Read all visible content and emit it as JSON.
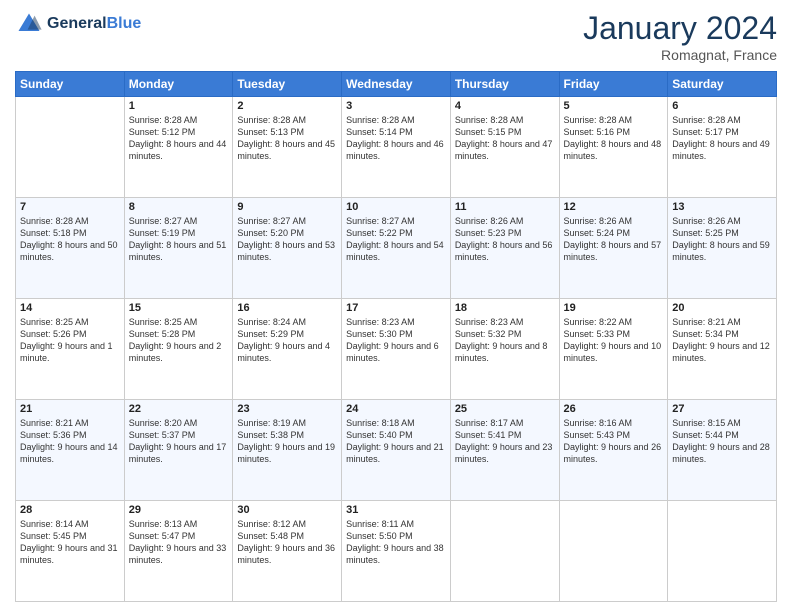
{
  "header": {
    "logo_general": "General",
    "logo_blue": "Blue",
    "month_title": "January 2024",
    "location": "Romagnat, France"
  },
  "days_of_week": [
    "Sunday",
    "Monday",
    "Tuesday",
    "Wednesday",
    "Thursday",
    "Friday",
    "Saturday"
  ],
  "weeks": [
    [
      {
        "day": "",
        "sunrise": "",
        "sunset": "",
        "daylight": ""
      },
      {
        "day": "1",
        "sunrise": "Sunrise: 8:28 AM",
        "sunset": "Sunset: 5:12 PM",
        "daylight": "Daylight: 8 hours and 44 minutes."
      },
      {
        "day": "2",
        "sunrise": "Sunrise: 8:28 AM",
        "sunset": "Sunset: 5:13 PM",
        "daylight": "Daylight: 8 hours and 45 minutes."
      },
      {
        "day": "3",
        "sunrise": "Sunrise: 8:28 AM",
        "sunset": "Sunset: 5:14 PM",
        "daylight": "Daylight: 8 hours and 46 minutes."
      },
      {
        "day": "4",
        "sunrise": "Sunrise: 8:28 AM",
        "sunset": "Sunset: 5:15 PM",
        "daylight": "Daylight: 8 hours and 47 minutes."
      },
      {
        "day": "5",
        "sunrise": "Sunrise: 8:28 AM",
        "sunset": "Sunset: 5:16 PM",
        "daylight": "Daylight: 8 hours and 48 minutes."
      },
      {
        "day": "6",
        "sunrise": "Sunrise: 8:28 AM",
        "sunset": "Sunset: 5:17 PM",
        "daylight": "Daylight: 8 hours and 49 minutes."
      }
    ],
    [
      {
        "day": "7",
        "sunrise": "Sunrise: 8:28 AM",
        "sunset": "Sunset: 5:18 PM",
        "daylight": "Daylight: 8 hours and 50 minutes."
      },
      {
        "day": "8",
        "sunrise": "Sunrise: 8:27 AM",
        "sunset": "Sunset: 5:19 PM",
        "daylight": "Daylight: 8 hours and 51 minutes."
      },
      {
        "day": "9",
        "sunrise": "Sunrise: 8:27 AM",
        "sunset": "Sunset: 5:20 PM",
        "daylight": "Daylight: 8 hours and 53 minutes."
      },
      {
        "day": "10",
        "sunrise": "Sunrise: 8:27 AM",
        "sunset": "Sunset: 5:22 PM",
        "daylight": "Daylight: 8 hours and 54 minutes."
      },
      {
        "day": "11",
        "sunrise": "Sunrise: 8:26 AM",
        "sunset": "Sunset: 5:23 PM",
        "daylight": "Daylight: 8 hours and 56 minutes."
      },
      {
        "day": "12",
        "sunrise": "Sunrise: 8:26 AM",
        "sunset": "Sunset: 5:24 PM",
        "daylight": "Daylight: 8 hours and 57 minutes."
      },
      {
        "day": "13",
        "sunrise": "Sunrise: 8:26 AM",
        "sunset": "Sunset: 5:25 PM",
        "daylight": "Daylight: 8 hours and 59 minutes."
      }
    ],
    [
      {
        "day": "14",
        "sunrise": "Sunrise: 8:25 AM",
        "sunset": "Sunset: 5:26 PM",
        "daylight": "Daylight: 9 hours and 1 minute."
      },
      {
        "day": "15",
        "sunrise": "Sunrise: 8:25 AM",
        "sunset": "Sunset: 5:28 PM",
        "daylight": "Daylight: 9 hours and 2 minutes."
      },
      {
        "day": "16",
        "sunrise": "Sunrise: 8:24 AM",
        "sunset": "Sunset: 5:29 PM",
        "daylight": "Daylight: 9 hours and 4 minutes."
      },
      {
        "day": "17",
        "sunrise": "Sunrise: 8:23 AM",
        "sunset": "Sunset: 5:30 PM",
        "daylight": "Daylight: 9 hours and 6 minutes."
      },
      {
        "day": "18",
        "sunrise": "Sunrise: 8:23 AM",
        "sunset": "Sunset: 5:32 PM",
        "daylight": "Daylight: 9 hours and 8 minutes."
      },
      {
        "day": "19",
        "sunrise": "Sunrise: 8:22 AM",
        "sunset": "Sunset: 5:33 PM",
        "daylight": "Daylight: 9 hours and 10 minutes."
      },
      {
        "day": "20",
        "sunrise": "Sunrise: 8:21 AM",
        "sunset": "Sunset: 5:34 PM",
        "daylight": "Daylight: 9 hours and 12 minutes."
      }
    ],
    [
      {
        "day": "21",
        "sunrise": "Sunrise: 8:21 AM",
        "sunset": "Sunset: 5:36 PM",
        "daylight": "Daylight: 9 hours and 14 minutes."
      },
      {
        "day": "22",
        "sunrise": "Sunrise: 8:20 AM",
        "sunset": "Sunset: 5:37 PM",
        "daylight": "Daylight: 9 hours and 17 minutes."
      },
      {
        "day": "23",
        "sunrise": "Sunrise: 8:19 AM",
        "sunset": "Sunset: 5:38 PM",
        "daylight": "Daylight: 9 hours and 19 minutes."
      },
      {
        "day": "24",
        "sunrise": "Sunrise: 8:18 AM",
        "sunset": "Sunset: 5:40 PM",
        "daylight": "Daylight: 9 hours and 21 minutes."
      },
      {
        "day": "25",
        "sunrise": "Sunrise: 8:17 AM",
        "sunset": "Sunset: 5:41 PM",
        "daylight": "Daylight: 9 hours and 23 minutes."
      },
      {
        "day": "26",
        "sunrise": "Sunrise: 8:16 AM",
        "sunset": "Sunset: 5:43 PM",
        "daylight": "Daylight: 9 hours and 26 minutes."
      },
      {
        "day": "27",
        "sunrise": "Sunrise: 8:15 AM",
        "sunset": "Sunset: 5:44 PM",
        "daylight": "Daylight: 9 hours and 28 minutes."
      }
    ],
    [
      {
        "day": "28",
        "sunrise": "Sunrise: 8:14 AM",
        "sunset": "Sunset: 5:45 PM",
        "daylight": "Daylight: 9 hours and 31 minutes."
      },
      {
        "day": "29",
        "sunrise": "Sunrise: 8:13 AM",
        "sunset": "Sunset: 5:47 PM",
        "daylight": "Daylight: 9 hours and 33 minutes."
      },
      {
        "day": "30",
        "sunrise": "Sunrise: 8:12 AM",
        "sunset": "Sunset: 5:48 PM",
        "daylight": "Daylight: 9 hours and 36 minutes."
      },
      {
        "day": "31",
        "sunrise": "Sunrise: 8:11 AM",
        "sunset": "Sunset: 5:50 PM",
        "daylight": "Daylight: 9 hours and 38 minutes."
      },
      {
        "day": "",
        "sunrise": "",
        "sunset": "",
        "daylight": ""
      },
      {
        "day": "",
        "sunrise": "",
        "sunset": "",
        "daylight": ""
      },
      {
        "day": "",
        "sunrise": "",
        "sunset": "",
        "daylight": ""
      }
    ]
  ]
}
